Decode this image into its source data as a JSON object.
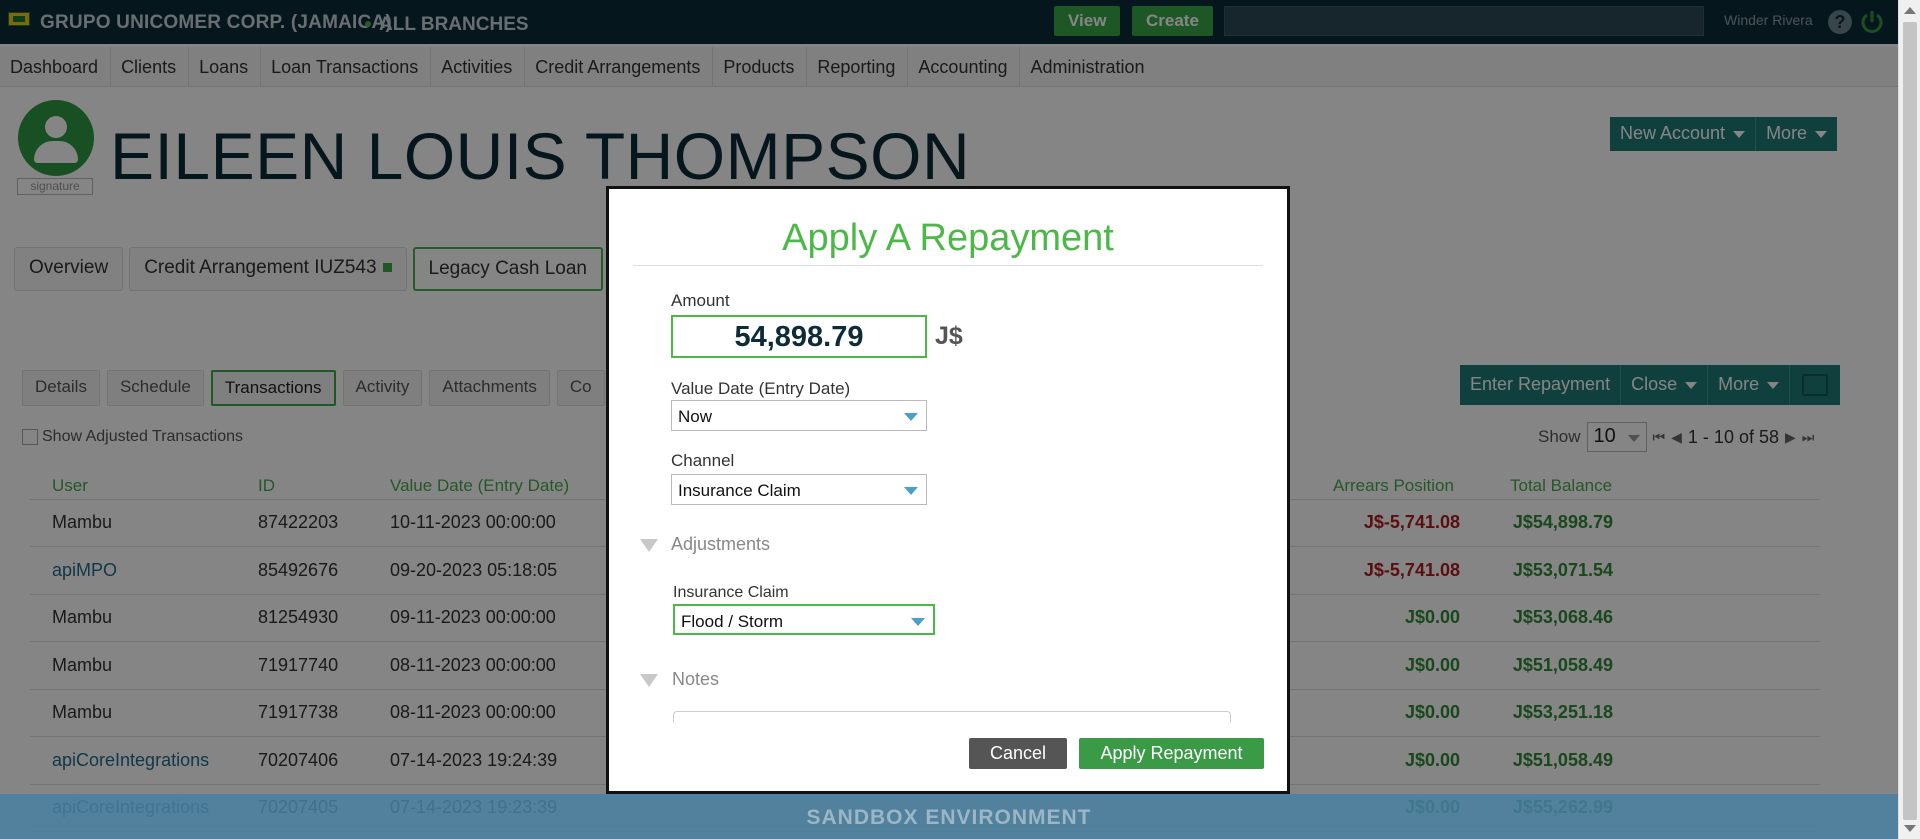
{
  "topbar": {
    "company": "GRUPO UNICOMER CORP. (JAMAICA)",
    "branch": "ALL BRANCHES",
    "view_label": "View",
    "create_label": "Create",
    "user_name": "Winder Rivera",
    "help_label": "?"
  },
  "nav": {
    "items": [
      "Dashboard",
      "Clients",
      "Loans",
      "Loan Transactions",
      "Activities",
      "Credit Arrangements",
      "Products",
      "Reporting",
      "Accounting",
      "Administration"
    ]
  },
  "client": {
    "name": "EILEEN LOUIS THOMPSON",
    "signature_label": "signature",
    "new_account_label": "New Account",
    "more_label": "More"
  },
  "account_tabs": {
    "overview": "Overview",
    "credit_arrangement": "Credit Arrangement IUZ543",
    "legacy_loan": "Legacy Cash Loan"
  },
  "sub_tabs": {
    "details": "Details",
    "schedule": "Schedule",
    "transactions": "Transactions",
    "activity": "Activity",
    "attachments": "Attachments",
    "comments_partial": "Co"
  },
  "actions": {
    "enter_repayment": "Enter Repayment",
    "close": "Close",
    "more": "More"
  },
  "filters": {
    "show_adjusted": "Show Adjusted Transactions",
    "show_label": "Show",
    "page_size": "10",
    "page_range": "1 - 10 of 58"
  },
  "table": {
    "headers": {
      "user": "User",
      "id": "ID",
      "value_date": "Value Date (Entry Date)",
      "arrears": "Arrears Position",
      "total_balance": "Total Balance"
    },
    "rows": [
      {
        "user": "Mambu",
        "id": "87422203",
        "date": "10-11-2023 00:00:00",
        "arrears": "J$-5,741.08",
        "balance": "J$54,898.79"
      },
      {
        "user": "apiMPO",
        "id": "85492676",
        "date": "09-20-2023 05:18:05",
        "arrears": "J$-5,741.08",
        "balance": "J$53,071.54"
      },
      {
        "user": "Mambu",
        "id": "81254930",
        "date": "09-11-2023 00:00:00",
        "arrears": "J$0.00",
        "balance": "J$53,068.46"
      },
      {
        "user": "Mambu",
        "id": "71917740",
        "date": "08-11-2023 00:00:00",
        "arrears": "J$0.00",
        "balance": "J$51,058.49"
      },
      {
        "user": "Mambu",
        "id": "71917738",
        "date": "08-11-2023 00:00:00",
        "arrears": "J$0.00",
        "balance": "J$53,251.18"
      },
      {
        "user": "apiCoreIntegrations",
        "id": "70207406",
        "date": "07-14-2023 19:24:39",
        "arrears": "J$0.00",
        "balance": "J$51,058.49"
      },
      {
        "user": "apiCoreIntegrations",
        "id": "70207405",
        "date": "07-14-2023 19:23:39",
        "arrears": "J$0.00",
        "balance": "J$55,262.99"
      }
    ]
  },
  "sandbox_label": "SANDBOX ENVIRONMENT",
  "modal": {
    "title": "Apply A Repayment",
    "amount_label": "Amount",
    "amount_value": "54,898.79",
    "currency": "J$",
    "value_date_label": "Value Date (Entry Date)",
    "value_date_value": "Now",
    "channel_label": "Channel",
    "channel_value": "Insurance Claim",
    "adjustments_label": "Adjustments",
    "insurance_claim_label": "Insurance Claim",
    "insurance_claim_value": "Flood / Storm",
    "notes_label": "Notes",
    "cancel_label": "Cancel",
    "apply_label": "Apply Repayment"
  },
  "colors": {
    "topbar_bg": "#0d2b38",
    "accent_green": "#4cb848",
    "teal_button": "#1f7c78",
    "arrears_red": "#b01c1c"
  }
}
